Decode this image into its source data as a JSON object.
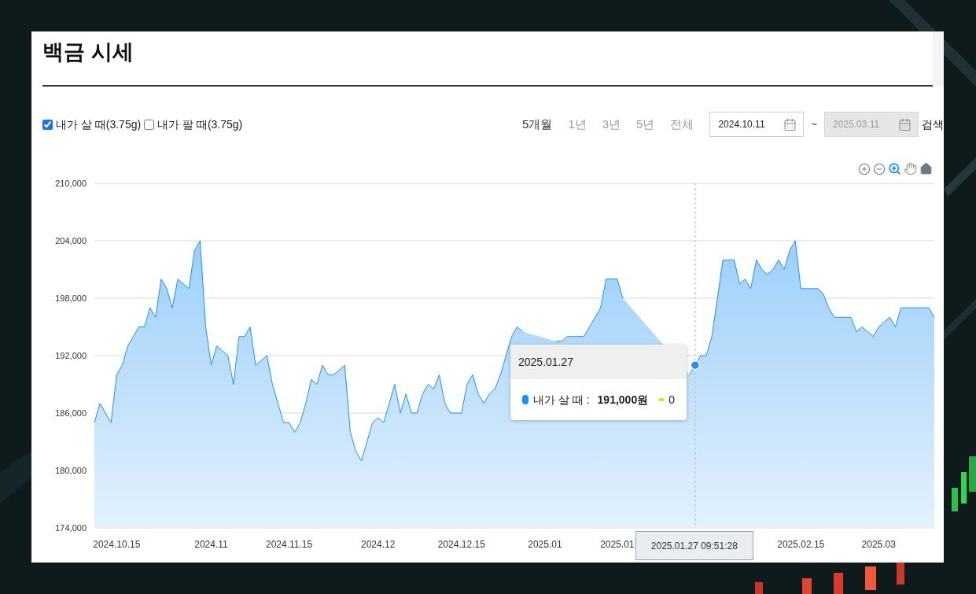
{
  "page": {
    "title": "백금 시세"
  },
  "filters": {
    "series_toggles": [
      {
        "label": "내가 살 때(3.75g)",
        "checked": true
      },
      {
        "label": "내가 팔 때(3.75g)",
        "checked": false
      }
    ],
    "periods": [
      {
        "label": "5개월",
        "selected": true
      },
      {
        "label": "1년",
        "selected": false
      },
      {
        "label": "3년",
        "selected": false
      },
      {
        "label": "5년",
        "selected": false
      },
      {
        "label": "전체",
        "selected": false
      }
    ],
    "start_date": {
      "value": "2024.10.11",
      "disabled": false
    },
    "separator": "~",
    "end_date": {
      "value": "2025.03.11",
      "disabled": true
    },
    "search_button": "검색"
  },
  "chart": {
    "chart_data": {
      "type": "area",
      "categories": [
        null,
        null,
        null,
        null,
        "2024.10.15",
        null,
        null,
        null,
        null,
        null,
        null,
        null,
        null,
        null,
        null,
        null,
        null,
        null,
        null,
        null,
        null,
        "2024.11",
        null,
        null,
        null,
        null,
        null,
        null,
        null,
        null,
        null,
        null,
        null,
        null,
        null,
        "2024.11.15",
        null,
        null,
        null,
        null,
        null,
        null,
        null,
        null,
        null,
        null,
        null,
        null,
        null,
        null,
        null,
        "2024.12",
        null,
        null,
        null,
        null,
        null,
        null,
        null,
        null,
        null,
        null,
        null,
        null,
        null,
        null,
        "2024.12.15",
        null,
        null,
        null,
        null,
        null,
        null,
        null,
        null,
        null,
        null,
        null,
        null,
        null,
        null,
        "2025.01",
        null,
        null,
        null,
        null,
        null,
        null,
        null,
        null,
        null,
        null,
        null,
        null,
        "2025.01",
        null,
        null,
        null,
        null,
        null,
        null,
        null,
        null,
        null,
        null,
        null,
        null,
        null,
        null,
        null,
        null,
        null,
        null,
        null,
        null,
        null,
        null,
        null,
        null,
        null,
        null,
        null,
        null,
        null,
        null,
        null,
        null,
        "2025.02.15",
        null,
        null,
        null,
        null,
        null,
        null,
        null,
        null,
        null,
        null,
        null,
        null,
        null,
        "2025.03",
        null,
        null,
        null,
        null,
        null,
        null,
        null,
        null,
        null,
        null
      ],
      "series": [
        {
          "color": "#1e90ff",
          "values": [
            185000,
            187000,
            186000,
            185000,
            190000,
            191000,
            193000,
            194000,
            195000,
            195000,
            197000,
            196000,
            200000,
            199000,
            197000,
            200000,
            199500,
            199000,
            203000,
            204000,
            195000,
            191000,
            193000,
            192500,
            192000,
            189000,
            194000,
            194000,
            195000,
            191000,
            191500,
            192000,
            189000,
            187000,
            185000,
            185000,
            184000,
            185000,
            187000,
            189500,
            189000,
            191000,
            190000,
            190000,
            190500,
            191000,
            184000,
            182000,
            181000,
            183000,
            185000,
            185500,
            185000,
            187000,
            189000,
            186000,
            188000,
            186000,
            186000,
            188000,
            189000,
            188500,
            190000,
            187000,
            186000,
            186000,
            186000,
            189000,
            190000,
            188000,
            187000,
            188000,
            188500,
            190000,
            192000,
            194000,
            195000,
            194500,
            null,
            null,
            null,
            null,
            null,
            193500,
            193500,
            194000,
            194000,
            194000,
            194000,
            195000,
            196000,
            197000,
            200000,
            200000,
            200000,
            198000,
            null,
            null,
            null,
            null,
            null,
            null,
            null,
            null,
            null,
            null,
            null,
            190000,
            191000,
            192000,
            192000,
            194000,
            198000,
            202000,
            202000,
            202000,
            199500,
            200000,
            199000,
            202000,
            201000,
            200500,
            201000,
            202000,
            201000,
            203000,
            204000,
            199000,
            199000,
            199000,
            199000,
            198500,
            197000,
            196000,
            196000,
            196000,
            196000,
            194500,
            195000,
            194500,
            194000,
            195000,
            195500,
            196000,
            195000,
            197000,
            197000,
            197000,
            197000,
            197000,
            197000,
            196000
          ]
        }
      ],
      "grid": true,
      "ylim": [
        174000,
        210000
      ],
      "yticks": [
        {
          "value": 210000,
          "label": "210,000"
        },
        {
          "value": 204000,
          "label": "204,000"
        },
        {
          "value": 198000,
          "label": "198,000"
        },
        {
          "value": 192000,
          "label": "192,000"
        },
        {
          "value": 186000,
          "label": "186,000"
        },
        {
          "value": 180000,
          "label": "180,000"
        },
        {
          "value": 174000,
          "label": "174,000"
        }
      ]
    },
    "crosshair": {
      "label": "2025.01.27 09:51:28"
    },
    "tooltip": {
      "date": "2025.01.27",
      "items": [
        {
          "kind": "dot",
          "color": "#1890ff",
          "label": "내가 살 때 :",
          "value": "191,000원"
        },
        {
          "kind": "dash",
          "color": "#ffd400",
          "value": "0"
        }
      ]
    }
  }
}
